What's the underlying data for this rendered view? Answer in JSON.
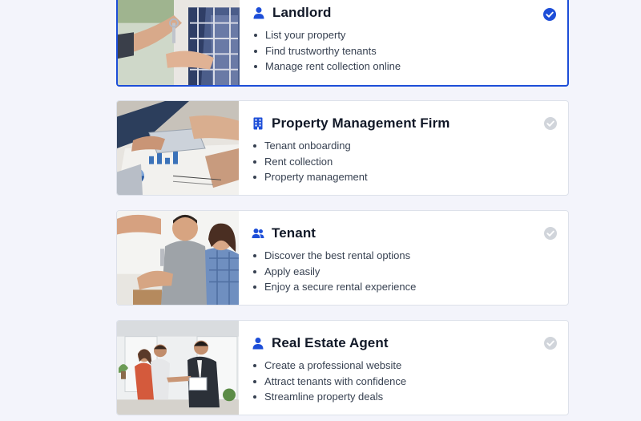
{
  "colors": {
    "accent": "#1d4ed8",
    "check_inactive": "#d1d5db",
    "background": "#f3f4fb",
    "card_border": "#dde1ea"
  },
  "roles": [
    {
      "title": "Landlord",
      "icon": "user-icon",
      "selected": true,
      "features": [
        "List your property",
        "Find trustworthy tenants",
        "Manage rent collection online"
      ]
    },
    {
      "title": "Property Management Firm",
      "icon": "building-icon",
      "selected": false,
      "features": [
        "Tenant onboarding",
        "Rent collection",
        "Property management"
      ]
    },
    {
      "title": "Tenant",
      "icon": "users-icon",
      "selected": false,
      "features": [
        "Discover the best rental options",
        "Apply easily",
        "Enjoy a secure rental experience"
      ]
    },
    {
      "title": "Real Estate Agent",
      "icon": "user-icon",
      "selected": false,
      "features": [
        "Create a professional website",
        "Attract tenants with confidence",
        "Streamline property deals"
      ]
    }
  ]
}
